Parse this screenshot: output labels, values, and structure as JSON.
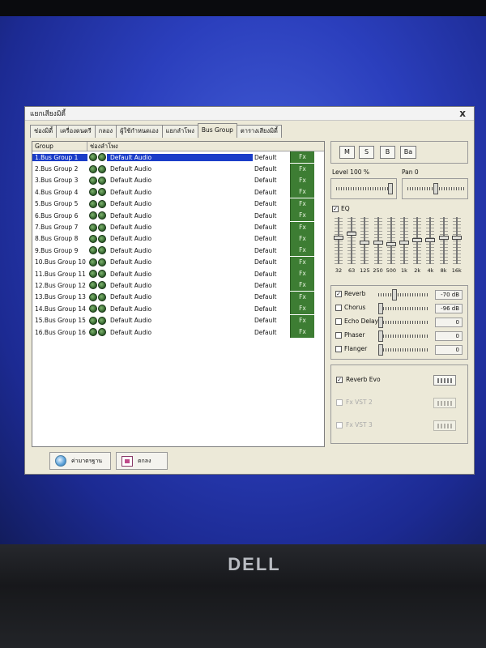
{
  "window": {
    "title": "แยกเสียงมิดี้",
    "close_label": "x"
  },
  "tabs": [
    {
      "label": "ช่องมิดี้",
      "active": false
    },
    {
      "label": "เครื่องดนตรี",
      "active": false
    },
    {
      "label": "กลอง",
      "active": false
    },
    {
      "label": "ผู้ใช้กำหนดเอง",
      "active": false
    },
    {
      "label": "แยกลำโพง",
      "active": false
    },
    {
      "label": "Bus Group",
      "active": true
    },
    {
      "label": "ตารางเสียงมิดี้",
      "active": false
    }
  ],
  "list": {
    "col_group": "Group",
    "col_speaker": "ช่องลำโพง",
    "rows": [
      {
        "name": "1.Bus Group 1",
        "device": "Default Audio",
        "mode": "Default",
        "fx": "Fx",
        "selected": true
      },
      {
        "name": "2.Bus Group 2",
        "device": "Default Audio",
        "mode": "Default",
        "fx": "Fx"
      },
      {
        "name": "3.Bus Group 3",
        "device": "Default Audio",
        "mode": "Default",
        "fx": "Fx"
      },
      {
        "name": "4.Bus Group 4",
        "device": "Default Audio",
        "mode": "Default",
        "fx": "Fx"
      },
      {
        "name": "5.Bus Group 5",
        "device": "Default Audio",
        "mode": "Default",
        "fx": "Fx"
      },
      {
        "name": "6.Bus Group 6",
        "device": "Default Audio",
        "mode": "Default",
        "fx": "Fx"
      },
      {
        "name": "7.Bus Group 7",
        "device": "Default Audio",
        "mode": "Default",
        "fx": "Fx"
      },
      {
        "name": "8.Bus Group 8",
        "device": "Default Audio",
        "mode": "Default",
        "fx": "Fx"
      },
      {
        "name": "9.Bus Group 9",
        "device": "Default Audio",
        "mode": "Default",
        "fx": "Fx"
      },
      {
        "name": "10.Bus Group 10",
        "device": "Default Audio",
        "mode": "Default",
        "fx": "Fx"
      },
      {
        "name": "11.Bus Group 11",
        "device": "Default Audio",
        "mode": "Default",
        "fx": "Fx"
      },
      {
        "name": "12.Bus Group 12",
        "device": "Default Audio",
        "mode": "Default",
        "fx": "Fx"
      },
      {
        "name": "13.Bus Group 13",
        "device": "Default Audio",
        "mode": "Default",
        "fx": "Fx"
      },
      {
        "name": "14.Bus Group 14",
        "device": "Default Audio",
        "mode": "Default",
        "fx": "Fx"
      },
      {
        "name": "15.Bus Group 15",
        "device": "Default Audio",
        "mode": "Default",
        "fx": "Fx"
      },
      {
        "name": "16.Bus Group 16",
        "device": "Default Audio",
        "mode": "Default",
        "fx": "Fx"
      }
    ]
  },
  "buttons": {
    "default_label": "ค่ามาตรฐาน",
    "ok_label": "ตกลง"
  },
  "mixer": {
    "buttons": [
      "M",
      "S",
      "B",
      "Ba"
    ],
    "level_label": "Level 100 %",
    "level_value": 1.0,
    "pan_label": "Pan 0",
    "pan_value": 0,
    "eq_label": "EQ",
    "eq_checked": true,
    "eq_bands": [
      {
        "label": "32",
        "level": 0.55
      },
      {
        "label": "63",
        "level": 0.65
      },
      {
        "label": "125",
        "level": 0.45
      },
      {
        "label": "250",
        "level": 0.45
      },
      {
        "label": "500",
        "level": 0.4
      },
      {
        "label": "1k",
        "level": 0.45
      },
      {
        "label": "2k",
        "level": 0.5
      },
      {
        "label": "4k",
        "level": 0.5
      },
      {
        "label": "8k",
        "level": 0.55
      },
      {
        "label": "16k",
        "level": 0.55
      }
    ],
    "effects": [
      {
        "label": "Reverb",
        "checked": true,
        "value": "-70 dB",
        "level": 0.3
      },
      {
        "label": "Chorus",
        "checked": false,
        "value": "-96 dB",
        "level": 0.0
      },
      {
        "label": "Echo Delay",
        "checked": false,
        "value": "0",
        "level": 0.0
      },
      {
        "label": "Phaser",
        "checked": false,
        "value": "0",
        "level": 0.0
      },
      {
        "label": "Flanger",
        "checked": false,
        "value": "0",
        "level": 0.0
      }
    ],
    "fx_slots": [
      {
        "label": "Reverb Evo",
        "checked": true,
        "enabled": true
      },
      {
        "label": "Fx VST 2",
        "checked": false,
        "enabled": false
      },
      {
        "label": "Fx VST 3",
        "checked": false,
        "enabled": false
      }
    ]
  },
  "brand": "DELL"
}
